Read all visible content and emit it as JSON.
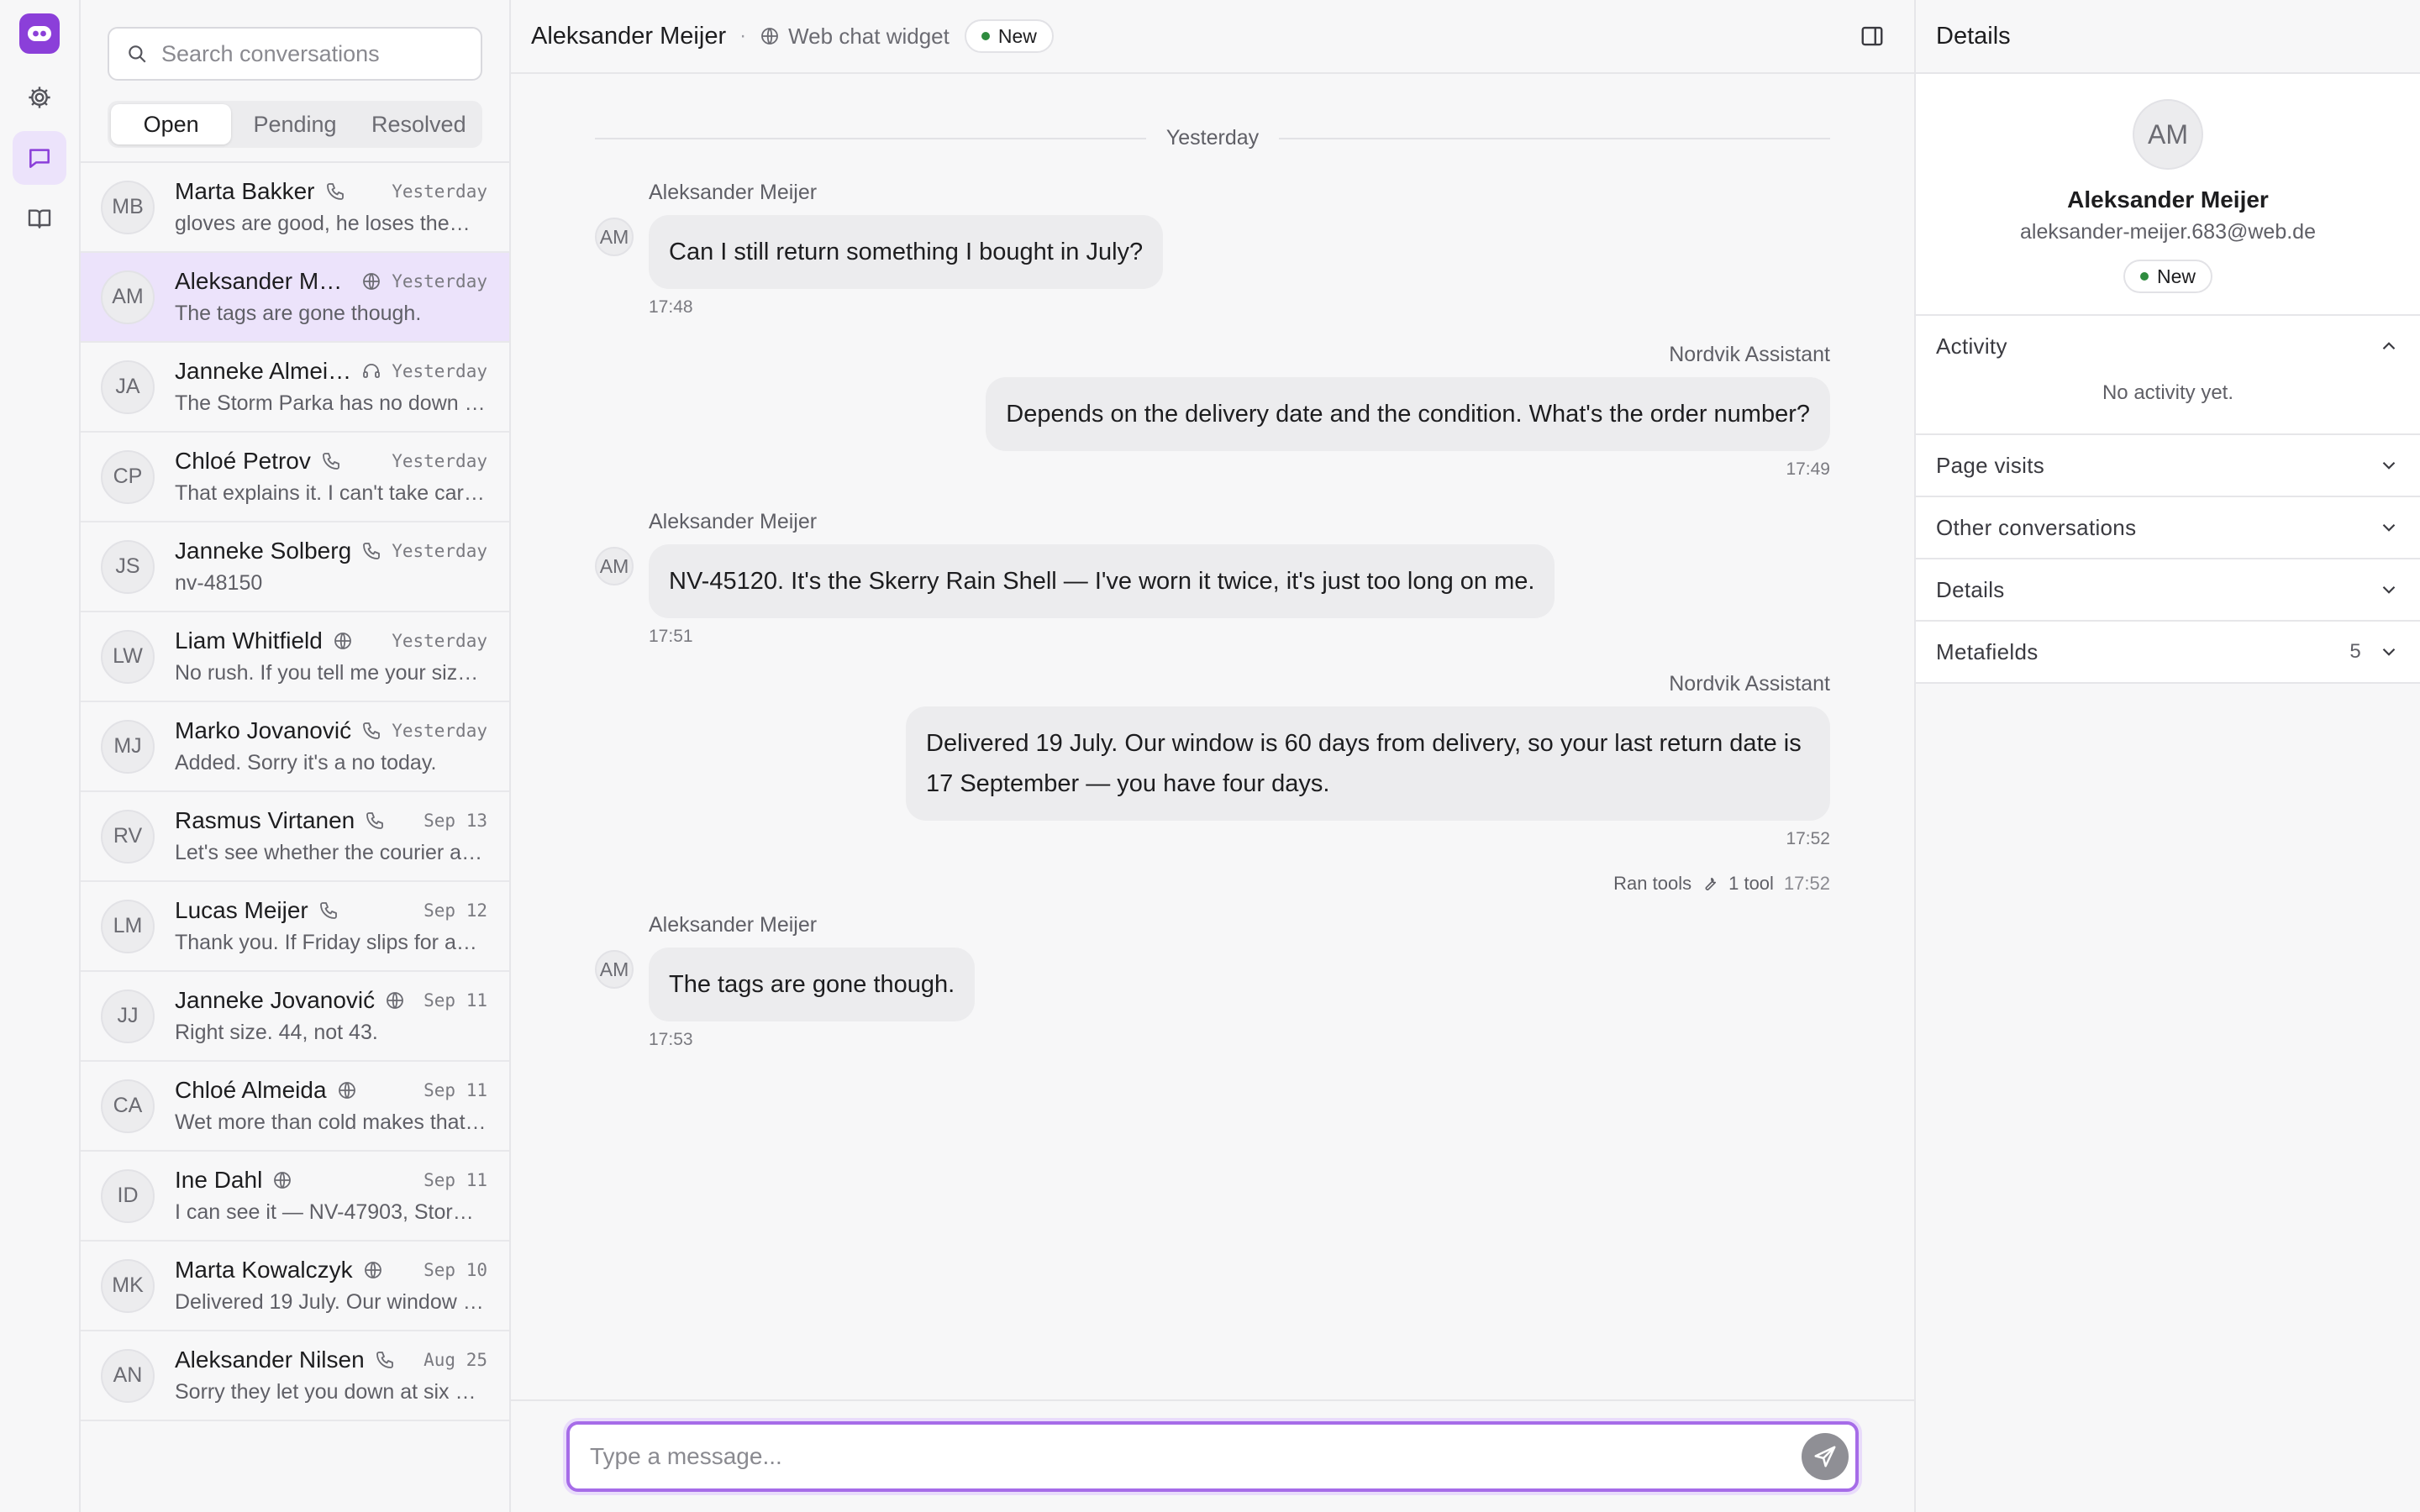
{
  "search": {
    "placeholder": "Search conversations"
  },
  "tabs": [
    {
      "label": "Open",
      "active": true
    },
    {
      "label": "Pending",
      "active": false
    },
    {
      "label": "Resolved",
      "active": false
    }
  ],
  "conversations": [
    {
      "initials": "MB",
      "name": "Marta Bakker",
      "channel": "phone",
      "time": "Yesterday",
      "preview": "gloves are good, he loses them…"
    },
    {
      "initials": "AM",
      "name": "Aleksander Mei…",
      "channel": "web",
      "time": "Yesterday",
      "preview": "The tags are gone though.",
      "active": true
    },
    {
      "initials": "JA",
      "name": "Janneke Almeida",
      "channel": "headset",
      "time": "Yesterday",
      "preview": "The Storm Parka has no down i…"
    },
    {
      "initials": "CP",
      "name": "Chloé Petrov",
      "channel": "phone",
      "time": "Yesterday",
      "preview": "That explains it. I can't take car…"
    },
    {
      "initials": "JS",
      "name": "Janneke Solberg",
      "channel": "phone",
      "time": "Yesterday",
      "preview": "nv-48150"
    },
    {
      "initials": "LW",
      "name": "Liam Whitfield",
      "channel": "web",
      "time": "Yesterday",
      "preview": "No rush. If you tell me your siz…"
    },
    {
      "initials": "MJ",
      "name": "Marko Jovanović",
      "channel": "phone",
      "time": "Yesterday",
      "preview": "Added. Sorry it's a no today."
    },
    {
      "initials": "RV",
      "name": "Rasmus Virtanen",
      "channel": "phone",
      "time": "Sep 13",
      "preview": "Let's see whether the courier a…"
    },
    {
      "initials": "LM",
      "name": "Lucas Meijer",
      "channel": "phone",
      "time": "Sep 12",
      "preview": "Thank you. If Friday slips for an…"
    },
    {
      "initials": "JJ",
      "name": "Janneke Jovanović",
      "channel": "web",
      "time": "Sep 11",
      "preview": "Right size. 44, not 43."
    },
    {
      "initials": "CA",
      "name": "Chloé Almeida",
      "channel": "web",
      "time": "Sep 11",
      "preview": "Wet more than cold makes that…"
    },
    {
      "initials": "ID",
      "name": "Ine Dahl",
      "channel": "web",
      "time": "Sep 11",
      "preview": "I can see it — NV-47903, Stor…"
    },
    {
      "initials": "MK",
      "name": "Marta Kowalczyk",
      "channel": "web",
      "time": "Sep 10",
      "preview": "Delivered 19 July. Our window i…"
    },
    {
      "initials": "AN",
      "name": "Aleksander Nilsen",
      "channel": "phone",
      "time": "Aug 25",
      "preview": "Sorry they let you down at six …"
    }
  ],
  "header": {
    "contact": "Aleksander Meijer",
    "separator": "·",
    "channel": "Web chat widget",
    "status": "New"
  },
  "thread": {
    "day_label": "Yesterday",
    "messages": [
      {
        "dir": "in",
        "sender": "Aleksander Meijer",
        "initials": "AM",
        "text": "Can I still return something I bought in July?",
        "time": "17:48"
      },
      {
        "dir": "out",
        "sender": "Nordvik Assistant",
        "text": "Depends on the delivery date and the condition. What's the order number?",
        "time": "17:49"
      },
      {
        "dir": "in",
        "sender": "Aleksander Meijer",
        "initials": "AM",
        "text": "NV-45120. It's the Skerry Rain Shell — I've worn it twice, it's just too long on me.",
        "time": "17:51"
      },
      {
        "dir": "out",
        "sender": "Nordvik Assistant",
        "text": "Delivered 19 July. Our window is 60 days from delivery, so your last return date is 17 September — you have four days.",
        "time": "17:52"
      },
      {
        "dir": "in",
        "sender": "Aleksander Meijer",
        "initials": "AM",
        "text": "The tags are gone though.",
        "time": "17:53"
      }
    ],
    "tools": {
      "label": "Ran tools",
      "count": "1 tool",
      "time": "17:52"
    }
  },
  "composer": {
    "placeholder": "Type a message..."
  },
  "details": {
    "title": "Details",
    "initials": "AM",
    "name": "Aleksander Meijer",
    "email": "aleksander-meijer.683@web.de",
    "status": "New",
    "sections": {
      "activity": "Activity",
      "activity_empty": "No activity yet.",
      "page_visits": "Page visits",
      "other_conversations": "Other conversations",
      "details": "Details",
      "metafields": "Metafields",
      "metafields_count": "5"
    }
  },
  "colors": {
    "accent": "#8b3fd9",
    "active_bg": "#ece3fb",
    "status_dot": "#2e8b3e"
  }
}
